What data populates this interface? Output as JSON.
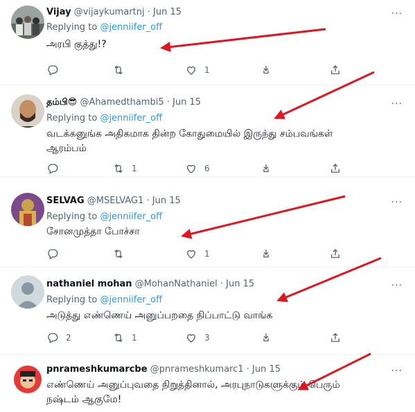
{
  "colors": {
    "accent": "#1d9bf0",
    "muted": "#536471",
    "annotation": "#e0151f"
  },
  "tweets": [
    {
      "display_name": "Vijay",
      "meta": "@vijaykumartnj · Jun 15",
      "replying_prefix": "Replying to",
      "replying_handle": "@jenniifer_off",
      "text": "அரபி குத்து!?",
      "reply_count": "",
      "retweet_count": "",
      "like_count": "1"
    },
    {
      "display_name": "தம்பி😎",
      "meta": "@Ahamedthambi5 · Jun 15",
      "replying_prefix": "Replying to",
      "replying_handle": "@jenniifer_off",
      "text": "வடக்கனுங்க அதிகமாக தின்ற கோதுமையில் இருந்து சம்பவங்கள் ஆரம்பம்",
      "reply_count": "",
      "retweet_count": "1",
      "like_count": "6"
    },
    {
      "display_name": "SELVAG",
      "meta": "@MSELVAG1 · Jun 15",
      "replying_prefix": "Replying to",
      "replying_handle": "@jenniifer_off",
      "text": "சோனமுத்தா போச்சா",
      "reply_count": "",
      "retweet_count": "",
      "like_count": "1"
    },
    {
      "display_name": "nathaniel mohan",
      "meta": "@MohanNathaniel · Jun 15",
      "replying_prefix": "Replying to",
      "replying_handle": "@jenniifer_off",
      "text": "அடுத்து எண்ணெய் அனுப்பறதை நிப்பாட்டு வாங்க",
      "reply_count": "2",
      "retweet_count": "1",
      "like_count": "3"
    },
    {
      "display_name": "pnrameshkumarcbe",
      "meta": "@pnrameshkumarc1 · Jun 15",
      "replying_prefix": "",
      "replying_handle": "",
      "text": "எண்ணெய் அனுப்புவதை நிறுத்தினால், அரபுநாடுகளுக்கும் பெரும் நஷ்டம் ஆகுமே!",
      "reply_count": "",
      "retweet_count": "",
      "like_count": ""
    }
  ],
  "more_label": "···"
}
